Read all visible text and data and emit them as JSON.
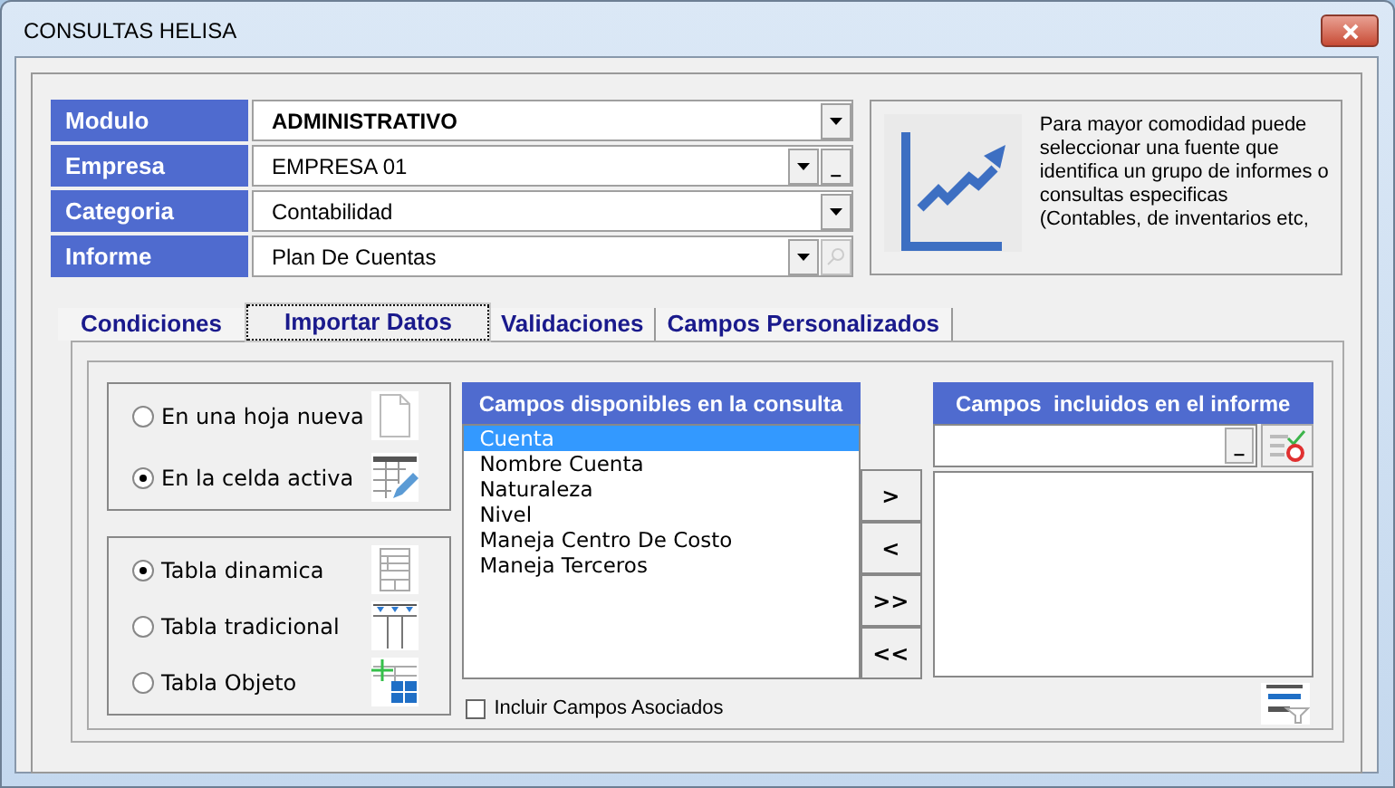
{
  "window": {
    "title": "CONSULTAS HELISA"
  },
  "fields": [
    {
      "label": "Modulo",
      "value": "ADMINISTRATIVO",
      "bold": true,
      "kind": "plain"
    },
    {
      "label": "Empresa",
      "value": "EMPRESA 01",
      "bold": false,
      "kind": "browse",
      "button": "_"
    },
    {
      "label": "Categoria",
      "value": "Contabilidad",
      "bold": false,
      "kind": "plain"
    },
    {
      "label": "Informe",
      "value": "Plan De Cuentas",
      "bold": false,
      "kind": "search",
      "disabled": true
    }
  ],
  "info": {
    "text": "Para mayor comodidad puede seleccionar una fuente que identifica un grupo de informes o consultas especificas (Contables, de inventarios etc,"
  },
  "tabs": [
    {
      "label": "Condiciones",
      "selected": false
    },
    {
      "label": "Importar Datos",
      "selected": true
    },
    {
      "label": "Validaciones",
      "selected": false
    },
    {
      "label": "Campos Personalizados",
      "selected": false
    }
  ],
  "destination": [
    {
      "label": "En una hoja nueva",
      "selected": false,
      "kind": "page"
    },
    {
      "label": "En la celda activa",
      "selected": true,
      "kind": "cell"
    }
  ],
  "table_type": [
    {
      "label": "Tabla dinamica",
      "selected": true,
      "kind": "pivot"
    },
    {
      "label": "Tabla tradicional",
      "selected": false,
      "kind": "columns"
    },
    {
      "label": "Tabla Objeto",
      "selected": false,
      "kind": "object"
    }
  ],
  "available": {
    "title": "Campos disponibles en la consulta",
    "items": [
      {
        "label": "Cuenta",
        "selected": true
      },
      {
        "label": "Nombre Cuenta",
        "selected": false
      },
      {
        "label": "Naturaleza",
        "selected": false
      },
      {
        "label": "Nivel",
        "selected": false
      },
      {
        "label": "Maneja Centro De Costo",
        "selected": false
      },
      {
        "label": "Maneja Terceros",
        "selected": false
      }
    ]
  },
  "move_buttons": [
    ">",
    "<",
    ">>",
    "<<"
  ],
  "included": {
    "title": "Campos  incluidos en el informe",
    "button": "_"
  },
  "include_associated": {
    "label": "Incluir Campos Asociados",
    "checked": false
  }
}
